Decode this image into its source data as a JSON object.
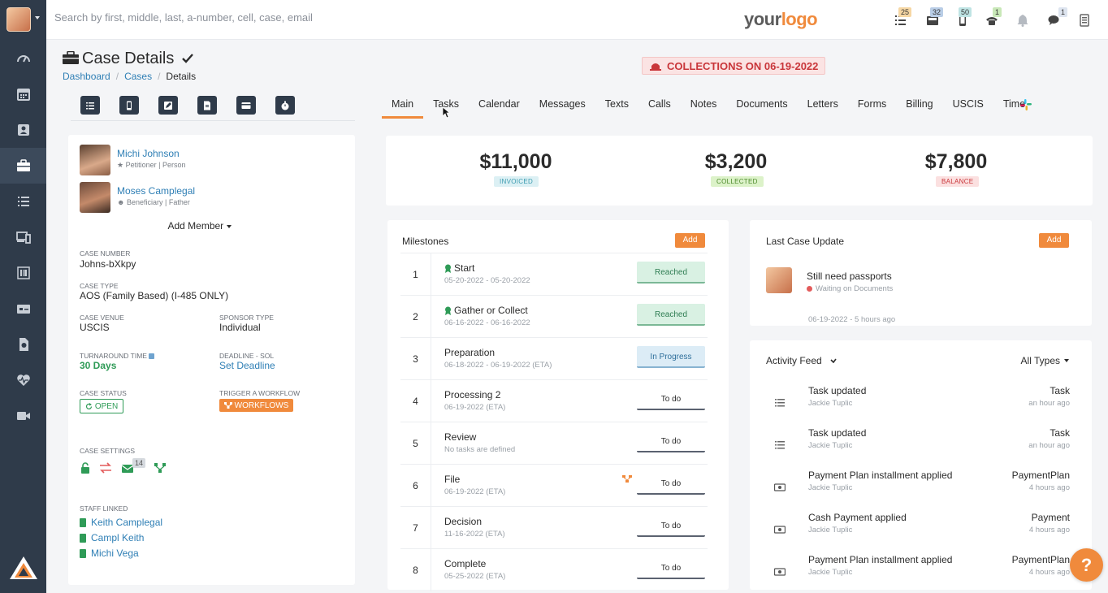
{
  "topbar": {
    "search_placeholder": "Search by first, middle, last, a-number, cell, case, email",
    "logo_part1": "your",
    "logo_part2": "logo",
    "badges": [
      "25",
      "32",
      "50",
      "1",
      "1"
    ]
  },
  "sidebar": {
    "items": [
      "dashboard-icon",
      "calendar-icon",
      "contacts-icon",
      "cases-icon",
      "tasks-icon",
      "devices-icon",
      "barcode-icon",
      "billing-icon",
      "documents-icon",
      "health-icon",
      "video-icon"
    ],
    "active": "cases-icon"
  },
  "header": {
    "title": "Case Details",
    "breadcrumb": [
      "Dashboard",
      "Cases",
      "Details"
    ],
    "alert": "COLLECTIONS ON 06-19-2022"
  },
  "tabs": [
    "Main",
    "Tasks",
    "Calendar",
    "Messages",
    "Texts",
    "Calls",
    "Notes",
    "Documents",
    "Letters",
    "Forms",
    "Billing",
    "USCIS",
    "Time"
  ],
  "active_tab": "Main",
  "case": {
    "members": [
      {
        "name": "Michi Johnson",
        "role": "Petitioner | Person"
      },
      {
        "name": "Moses Camplegal",
        "role": "Beneficiary | Father"
      }
    ],
    "add_member": "Add Member",
    "case_number_label": "CASE NUMBER",
    "case_number": "Johns-bXkpy",
    "case_type_label": "CASE TYPE",
    "case_type": "AOS (Family Based) (I-485 ONLY)",
    "venue_label": "CASE VENUE",
    "venue": "USCIS",
    "sponsor_label": "SPONSOR TYPE",
    "sponsor": "Individual",
    "turnaround_label": "TURNAROUND TIME",
    "turnaround": "30 Days",
    "deadline_label": "DEADLINE - SOL",
    "deadline": "Set Deadline",
    "status_label": "CASE STATUS",
    "status": "OPEN",
    "workflow_label": "TRIGGER A WORKFLOW",
    "workflow": "WORKFLOWS",
    "settings_label": "CASE SETTINGS",
    "settings_count": "14",
    "staff_label": "STAFF LINKED",
    "staff": [
      "Keith Camplegal",
      "Campl Keith",
      "Michi Vega"
    ]
  },
  "summary": {
    "invoiced": "$11,000",
    "invoiced_label": "INVOICED",
    "collected": "$3,200",
    "collected_label": "COLLECTED",
    "balance": "$7,800",
    "balance_label": "BALANCE"
  },
  "milestones": {
    "title": "Milestones",
    "add": "Add",
    "rows": [
      {
        "num": "1",
        "name": "Start",
        "date": "05-20-2022 - 05-20-2022",
        "status": "Reached"
      },
      {
        "num": "2",
        "name": "Gather or Collect",
        "date": "06-16-2022 - 06-16-2022",
        "status": "Reached"
      },
      {
        "num": "3",
        "name": "Preparation",
        "date": "06-18-2022 - 06-19-2022 (ETA)",
        "status": "In Progress"
      },
      {
        "num": "4",
        "name": "Processing 2",
        "date": "06-19-2022 (ETA)",
        "status": "To do"
      },
      {
        "num": "5",
        "name": "Review",
        "date": "No tasks are defined",
        "status": "To do"
      },
      {
        "num": "6",
        "name": "File",
        "date": "06-19-2022 (ETA)",
        "status": "To do"
      },
      {
        "num": "7",
        "name": "Decision",
        "date": "11-16-2022 (ETA)",
        "status": "To do"
      },
      {
        "num": "8",
        "name": "Complete",
        "date": "05-25-2022 (ETA)",
        "status": "To do"
      }
    ]
  },
  "last_update": {
    "title": "Last Case Update",
    "add": "Add",
    "text": "Still need passports",
    "status": "Waiting on Documents",
    "time": "06-19-2022 - 5 hours ago"
  },
  "activity": {
    "title": "Activity Feed",
    "filter": "All Types",
    "rows": [
      {
        "title": "Task updated",
        "user": "Jackie Tuplic",
        "type": "Task",
        "time": "an hour ago",
        "icon": "task-icon"
      },
      {
        "title": "Task updated",
        "user": "Jackie Tuplic",
        "type": "Task",
        "time": "an hour ago",
        "icon": "task-icon"
      },
      {
        "title": "Payment Plan installment applied",
        "user": "Jackie Tuplic",
        "type": "PaymentPlan",
        "time": "4 hours ago",
        "icon": "money-icon"
      },
      {
        "title": "Cash Payment applied",
        "user": "Jackie Tuplic",
        "type": "Payment",
        "time": "4 hours ago",
        "icon": "money-icon"
      },
      {
        "title": "Payment Plan installment applied",
        "user": "Jackie Tuplic",
        "type": "PaymentPlan",
        "time": "4 hours ago",
        "icon": "money-icon"
      }
    ]
  },
  "help": "?"
}
